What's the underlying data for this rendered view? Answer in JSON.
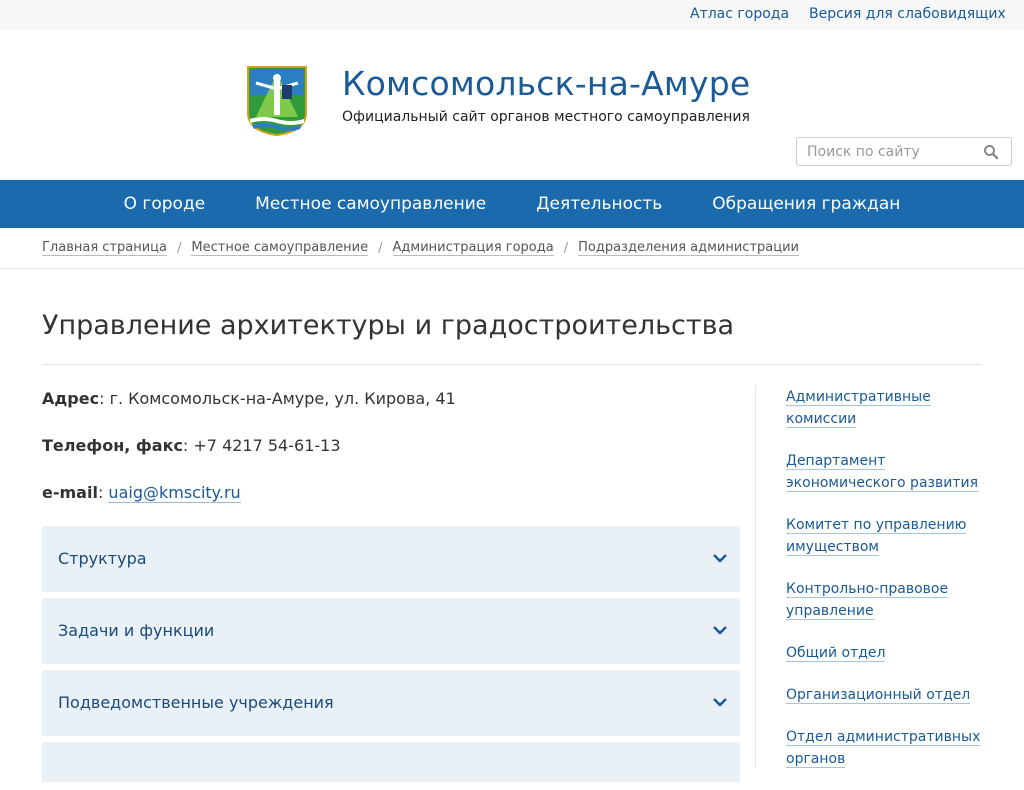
{
  "topbar": {
    "atlas": "Атлас города",
    "low_vision": "Версия для слабовидящих"
  },
  "header": {
    "title": "Комсомольск-на-Амуре",
    "subtitle": "Официальный сайт органов местного самоуправления",
    "search_placeholder": "Поиск по сайту"
  },
  "nav": {
    "items": [
      "О городе",
      "Местное самоуправление",
      "Деятельность",
      "Обращения граждан"
    ]
  },
  "breadcrumb": [
    "Главная страница",
    "Местное самоуправление",
    "Администрация города",
    "Подразделения администрации"
  ],
  "page": {
    "title": "Управление архитектуры и градостроительства",
    "address_label": "Адрес",
    "address_value": ": г. Комсомольск-на-Амуре, ул. Кирова, 41",
    "phone_label": "Телефон, факс",
    "phone_value": ": +7 4217 54-61-13",
    "email_label": "e-mail",
    "email_sep": ": ",
    "email_value": "uaig@kmscity.ru"
  },
  "accordion": [
    "Структура",
    "Задачи и функции",
    "Подведомственные учреждения"
  ],
  "sidebar": [
    "Административные комиссии",
    "Департамент экономического развития",
    "Комитет по управлению имуществом",
    "Контрольно-правовое управление",
    "Общий отдел",
    "Организационный отдел",
    "Отдел административных органов"
  ],
  "colors": {
    "accent": "#1a6aad",
    "link": "#1a5a96",
    "accordion_bg": "#e9f0f6"
  },
  "icons": {
    "emblem": "city-coat-of-arms",
    "search": "search-icon",
    "chevron": "chevron-down-icon"
  }
}
